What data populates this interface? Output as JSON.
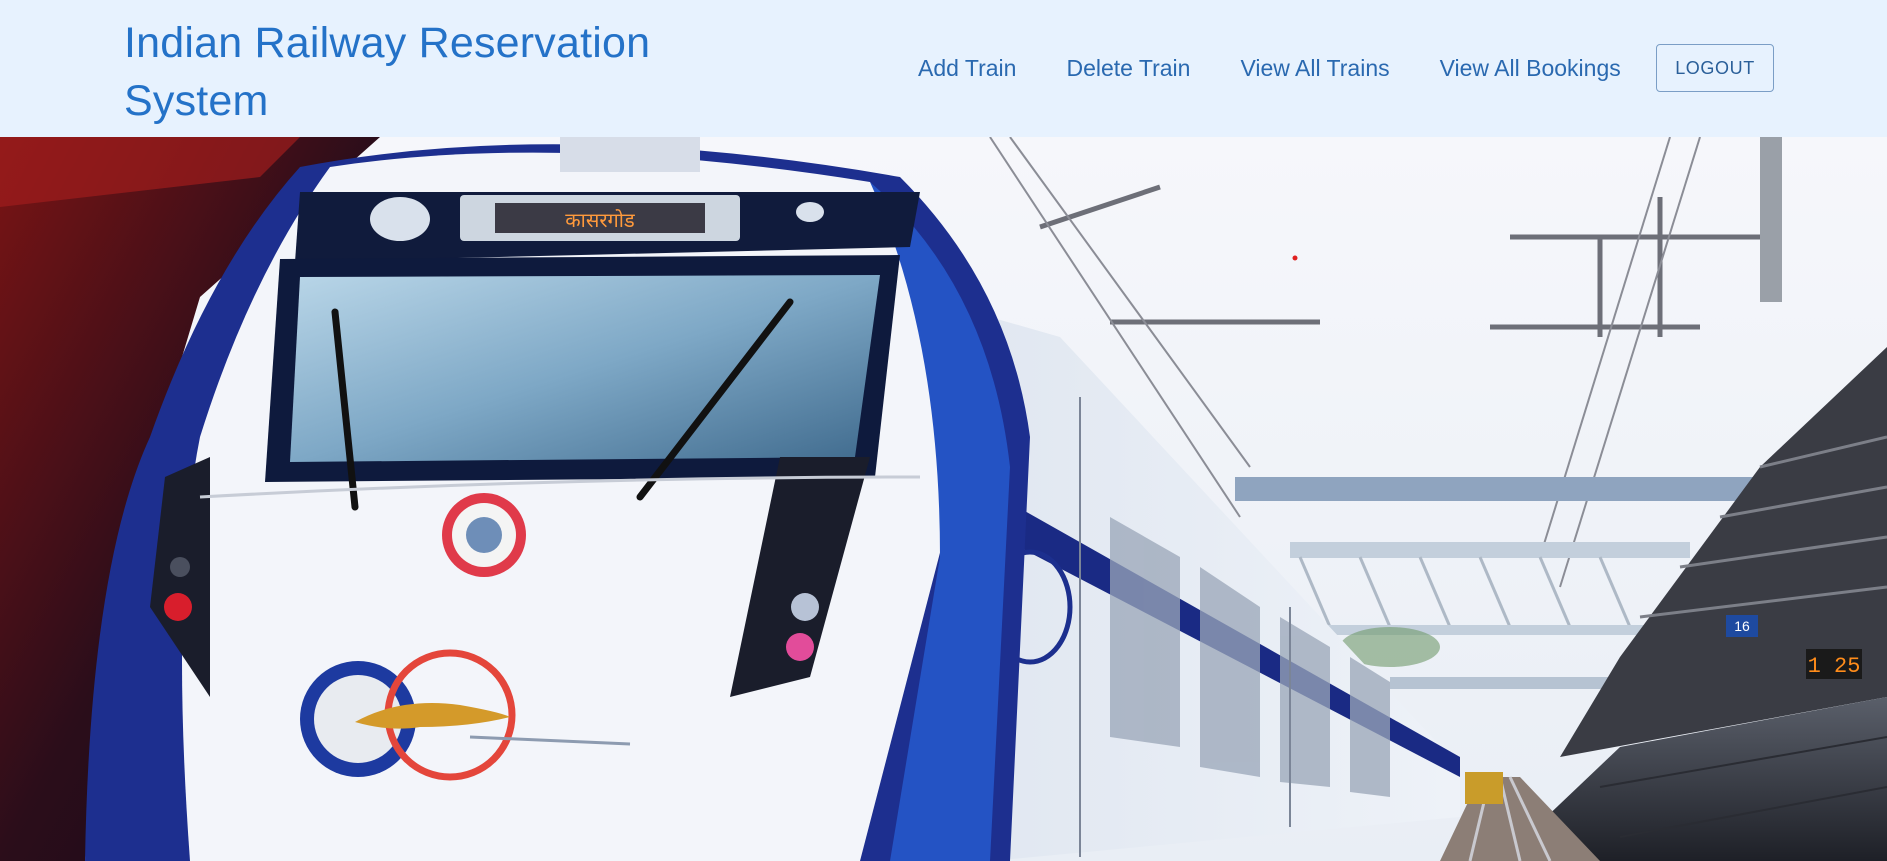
{
  "app": {
    "title": "Indian Railway Reservation System"
  },
  "nav": {
    "items": [
      {
        "label": "Add Train"
      },
      {
        "label": "Delete Train"
      },
      {
        "label": "View All Trains"
      },
      {
        "label": "View All Bookings"
      }
    ],
    "logout_label": "LOGOUT"
  },
  "hero": {
    "destination_board": "कासरगोड",
    "platform_number": "16",
    "clock": "1 25"
  },
  "colors": {
    "brand": "#2472c8",
    "navbar_bg": "#e7f2fe",
    "train_blue": "#1c2f8e",
    "train_white": "#f3f5fa"
  }
}
